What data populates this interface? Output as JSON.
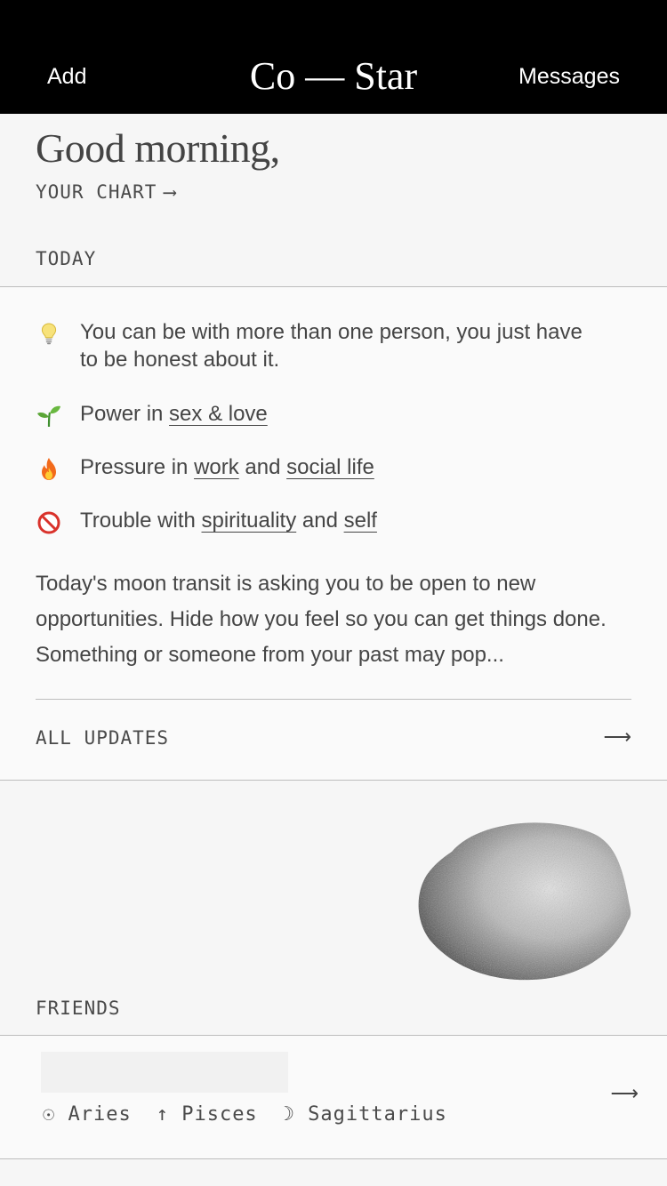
{
  "header": {
    "add_label": "Add",
    "logo": "Co — Star",
    "messages_label": "Messages"
  },
  "greeting": {
    "text": "Good morning,",
    "your_chart": "YOUR CHART",
    "arrow": "⟶"
  },
  "today": {
    "label": "TODAY",
    "items": [
      {
        "icon": "lightbulb-icon",
        "text": "You can be with more than one person, you just have to be honest about it."
      },
      {
        "icon": "seedling-icon",
        "prefix": "Power in ",
        "link1": "sex & love"
      },
      {
        "icon": "fire-icon",
        "prefix": "Pressure in ",
        "link1": "work",
        "joiner": " and ",
        "link2": "social life"
      },
      {
        "icon": "prohibited-icon",
        "prefix": "Trouble with ",
        "link1": "spirituality",
        "joiner": " and ",
        "link2": "self"
      }
    ],
    "summary": "Today's moon transit is asking you to be open to new opportunities. Hide how you feel so you can get things done. Something or someone from your past may pop...",
    "all_updates": "ALL UPDATES",
    "arrow": "⟶"
  },
  "friends": {
    "label": "FRIENDS",
    "row": {
      "sun": "☉ Aries",
      "rising": "↑ Pisces",
      "moon": "☽ Sagittarius",
      "arrow": "⟶"
    }
  },
  "colors": {
    "header_bg": "#000000",
    "page_bg": "#f6f6f6",
    "card_bg": "#fafafa",
    "text": "#454545"
  }
}
